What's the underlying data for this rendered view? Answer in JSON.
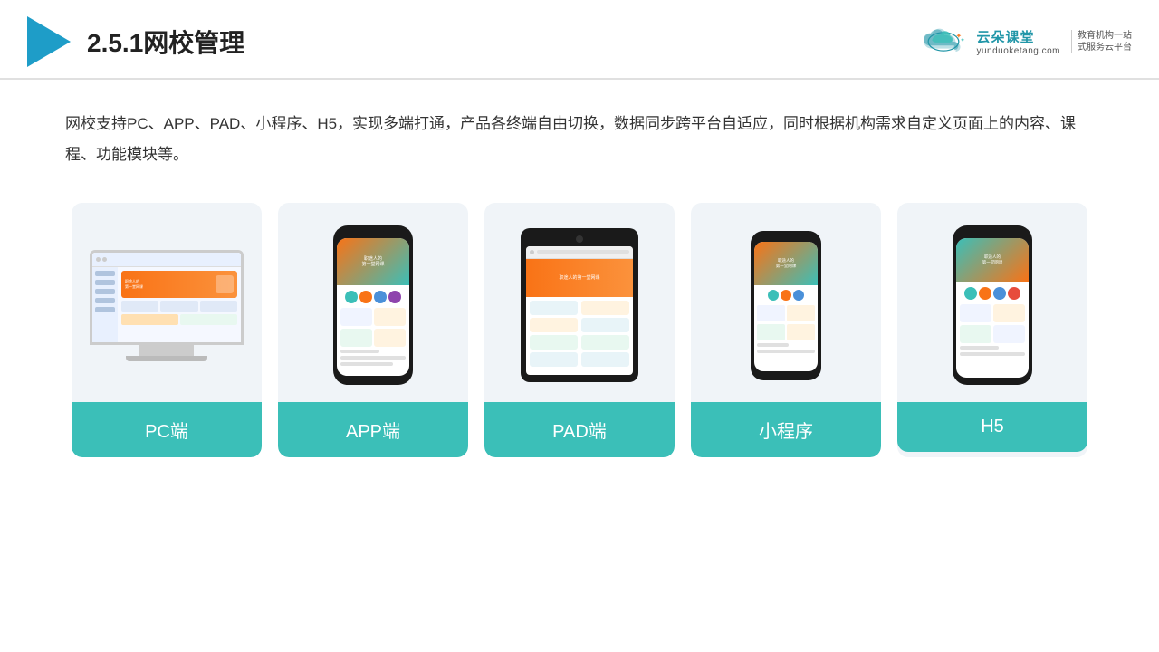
{
  "header": {
    "title": "2.5.1网校管理",
    "brand_main": "云朵课堂",
    "brand_url": "yunduoketang.com",
    "brand_slogan_line1": "教育机构一站",
    "brand_slogan_line2": "式服务云平台"
  },
  "description": {
    "text": "网校支持PC、APP、PAD、小程序、H5，实现多端打通，产品各终端自由切换，数据同步跨平台自适应，同时根据机构需求自定义页面上的内容、课程、功能模块等。"
  },
  "cards": [
    {
      "label": "PC端",
      "type": "pc"
    },
    {
      "label": "APP端",
      "type": "app"
    },
    {
      "label": "PAD端",
      "type": "pad"
    },
    {
      "label": "小程序",
      "type": "miniapp"
    },
    {
      "label": "H5",
      "type": "h5"
    }
  ]
}
